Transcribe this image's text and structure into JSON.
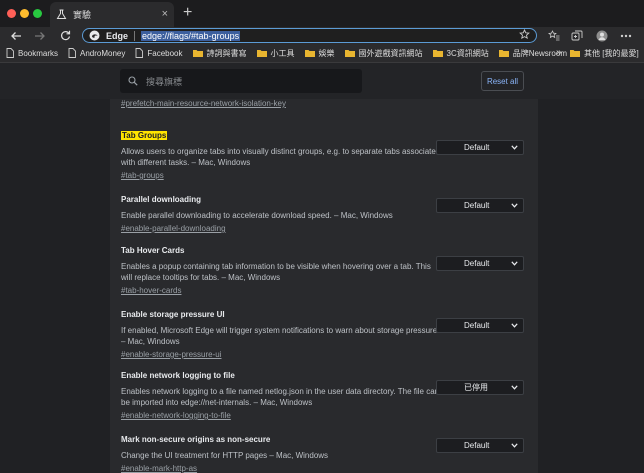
{
  "tab": {
    "title": "實驗",
    "close": "×",
    "new_tab": "+"
  },
  "omnibox": {
    "site": "Edge",
    "url": "edge://flags/#tab-groups"
  },
  "bookmarks": [
    {
      "label": "Bookmarks",
      "icon": "page-icon"
    },
    {
      "label": "AndroMoney",
      "icon": "page-icon"
    },
    {
      "label": "Facebook",
      "icon": "page-icon"
    },
    {
      "label": "詩詞與書寫",
      "icon": "folder-icon"
    },
    {
      "label": "小工具",
      "icon": "folder-icon"
    },
    {
      "label": "娛樂",
      "icon": "folder-icon"
    },
    {
      "label": "國外遊戲資訊網站",
      "icon": "folder-icon"
    },
    {
      "label": "3C資訊網站",
      "icon": "folder-icon"
    },
    {
      "label": "品牌Newsroom",
      "icon": "folder-icon"
    }
  ],
  "bookmarks_more": "»",
  "other_bookmarks": "其他 [我的最愛]",
  "flags": {
    "search_placeholder": "搜尋旗標",
    "reset_label": "Reset all",
    "previous_anchor": "#prefetch-main-resource-network-isolation-key",
    "experiments": [
      {
        "name": "Tab Groups",
        "highlighted": true,
        "description": "Allows users to organize tabs into visually distinct groups, e.g. to separate tabs associated with different tasks. – Mac, Windows",
        "anchor": "#tab-groups",
        "value": "Default"
      },
      {
        "name": "Parallel downloading",
        "highlighted": false,
        "description": "Enable parallel downloading to accelerate download speed. – Mac, Windows",
        "anchor": "#enable-parallel-downloading",
        "value": "Default"
      },
      {
        "name": "Tab Hover Cards",
        "highlighted": false,
        "description": "Enables a popup containing tab information to be visible when hovering over a tab. This will replace tooltips for tabs. – Mac, Windows",
        "anchor": "#tab-hover-cards",
        "value": "Default"
      },
      {
        "name": "Enable storage pressure UI",
        "highlighted": false,
        "description": "If enabled, Microsoft Edge will trigger system notifications to warn about storage pressure. – Mac, Windows",
        "anchor": "#enable-storage-pressure-ui",
        "value": "Default"
      },
      {
        "name": "Enable network logging to file",
        "highlighted": false,
        "description": "Enables network logging to a file named netlog.json in the user data directory. The file can be imported into edge://net-internals. – Mac, Windows",
        "anchor": "#enable-network-logging-to-file",
        "value": "已停用"
      },
      {
        "name": "Mark non-secure origins as non-secure",
        "highlighted": false,
        "description": "Change the UI treatment for HTTP pages – Mac, Windows",
        "anchor": "#enable-mark-http-as",
        "value": "Default"
      }
    ]
  }
}
